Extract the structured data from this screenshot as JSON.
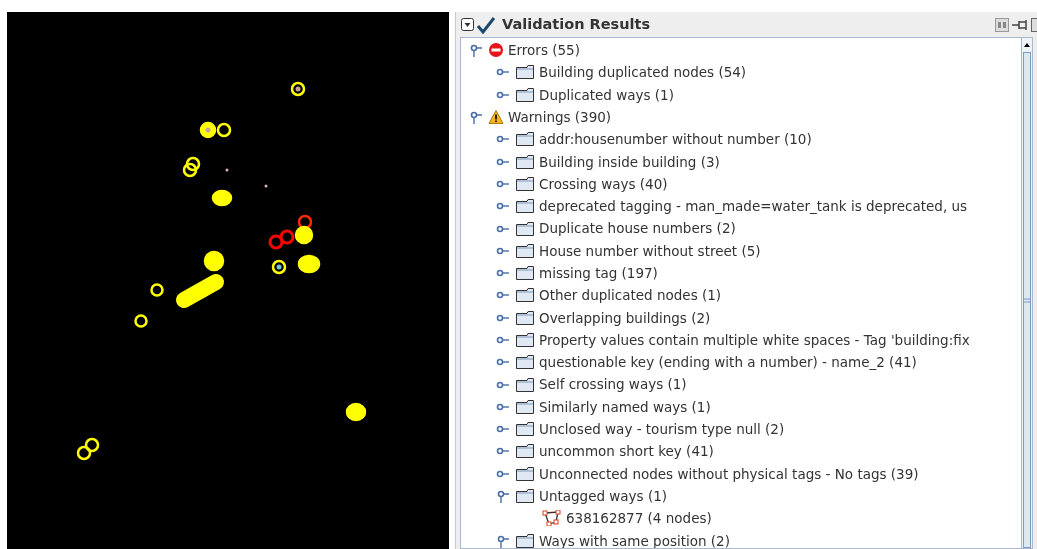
{
  "panel": {
    "title": "Validation Results"
  },
  "tree": [
    {
      "kind": "error",
      "label": "Errors (55)",
      "expanded": true,
      "children": [
        {
          "kind": "group",
          "label": "Building duplicated nodes (54)",
          "expanded": false
        },
        {
          "kind": "group",
          "label": "Duplicated ways (1)",
          "expanded": false
        }
      ]
    },
    {
      "kind": "warning",
      "label": "Warnings (390)",
      "expanded": true,
      "children": [
        {
          "kind": "group",
          "label": "addr:housenumber without number (10)",
          "expanded": false
        },
        {
          "kind": "group",
          "label": "Building inside building (3)",
          "expanded": false
        },
        {
          "kind": "group",
          "label": "Crossing ways (40)",
          "expanded": false
        },
        {
          "kind": "group",
          "label": "deprecated tagging - man_made=water_tank is deprecated, us",
          "expanded": false
        },
        {
          "kind": "group",
          "label": "Duplicate house numbers (2)",
          "expanded": false
        },
        {
          "kind": "group",
          "label": "House number without street (5)",
          "expanded": false
        },
        {
          "kind": "group",
          "label": "missing tag (197)",
          "expanded": false
        },
        {
          "kind": "group",
          "label": "Other duplicated nodes (1)",
          "expanded": false
        },
        {
          "kind": "group",
          "label": "Overlapping buildings (2)",
          "expanded": false
        },
        {
          "kind": "group",
          "label": "Property values contain multiple white spaces - Tag 'building:fix",
          "expanded": false
        },
        {
          "kind": "group",
          "label": "questionable key (ending with a number) - name_2 (41)",
          "expanded": false
        },
        {
          "kind": "group",
          "label": "Self crossing ways (1)",
          "expanded": false
        },
        {
          "kind": "group",
          "label": "Similarly named ways (1)",
          "expanded": false
        },
        {
          "kind": "group",
          "label": "Unclosed way - tourism type null (2)",
          "expanded": false
        },
        {
          "kind": "group",
          "label": "uncommon short key (41)",
          "expanded": false
        },
        {
          "kind": "group",
          "label": "Unconnected nodes without physical tags - No tags (39)",
          "expanded": false
        },
        {
          "kind": "group",
          "label": "Untagged ways (1)",
          "expanded": true,
          "children": [
            {
              "kind": "way",
              "label": "638162877 (4 nodes)"
            }
          ]
        },
        {
          "kind": "group",
          "label": "Ways with same position (2)",
          "expanded": true
        }
      ]
    }
  ]
}
